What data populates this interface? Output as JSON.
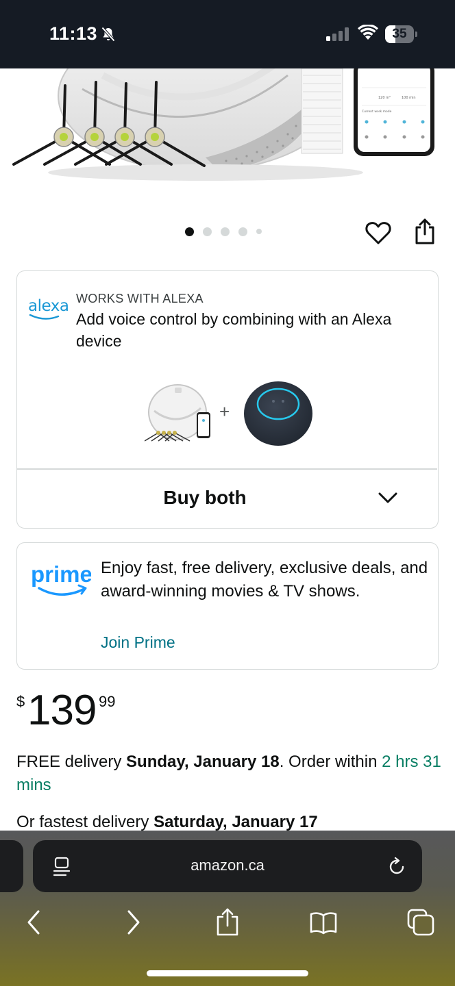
{
  "status_bar": {
    "time": "11:13",
    "battery_level": "35",
    "battery_fraction": 0.35,
    "icons": [
      "bell-slash-icon",
      "cellular-signal-icon",
      "wifi-icon",
      "battery-icon"
    ]
  },
  "hero": {
    "icons": [
      "robot-vacuum-image",
      "side-brush-image",
      "filter-image",
      "phone-app-image"
    ]
  },
  "carousel": {
    "dot_count": 5,
    "active_index": 0,
    "icons": [
      "heart-icon",
      "share-icon"
    ]
  },
  "alexa_card": {
    "logo_text": "alexa",
    "small_label": "WORKS WITH ALEXA",
    "description": "Add voice control by combining with an Alexa device",
    "plus": "+",
    "buy_both_label": "Buy both",
    "icons": [
      "chevron-down-icon"
    ]
  },
  "prime_card": {
    "logo_text": "prime",
    "description": "Enjoy fast, free delivery, exclusive deals, and award-winning movies & TV shows.",
    "link_label": "Join Prime"
  },
  "price": {
    "symbol": "$",
    "whole": "139",
    "fraction": "99"
  },
  "delivery": {
    "prefix": "FREE delivery ",
    "date": "Sunday, January 18",
    "middle": ". Order within ",
    "countdown": "2 hrs 31 mins"
  },
  "fastest": {
    "prefix": "Or fastest delivery ",
    "date": "Saturday, January 17"
  },
  "browser": {
    "url": "amazon.ca",
    "icons": [
      "page-menu-icon",
      "reload-icon",
      "back-icon",
      "forward-icon",
      "share-icon",
      "bookmarks-icon",
      "tabs-icon"
    ]
  },
  "colors": {
    "status_bar_bg": "#151b24",
    "link": "#007185",
    "countdown": "#067d62",
    "alexa_blue": "#1a98d5",
    "prime_blue": "#1a98ff"
  }
}
